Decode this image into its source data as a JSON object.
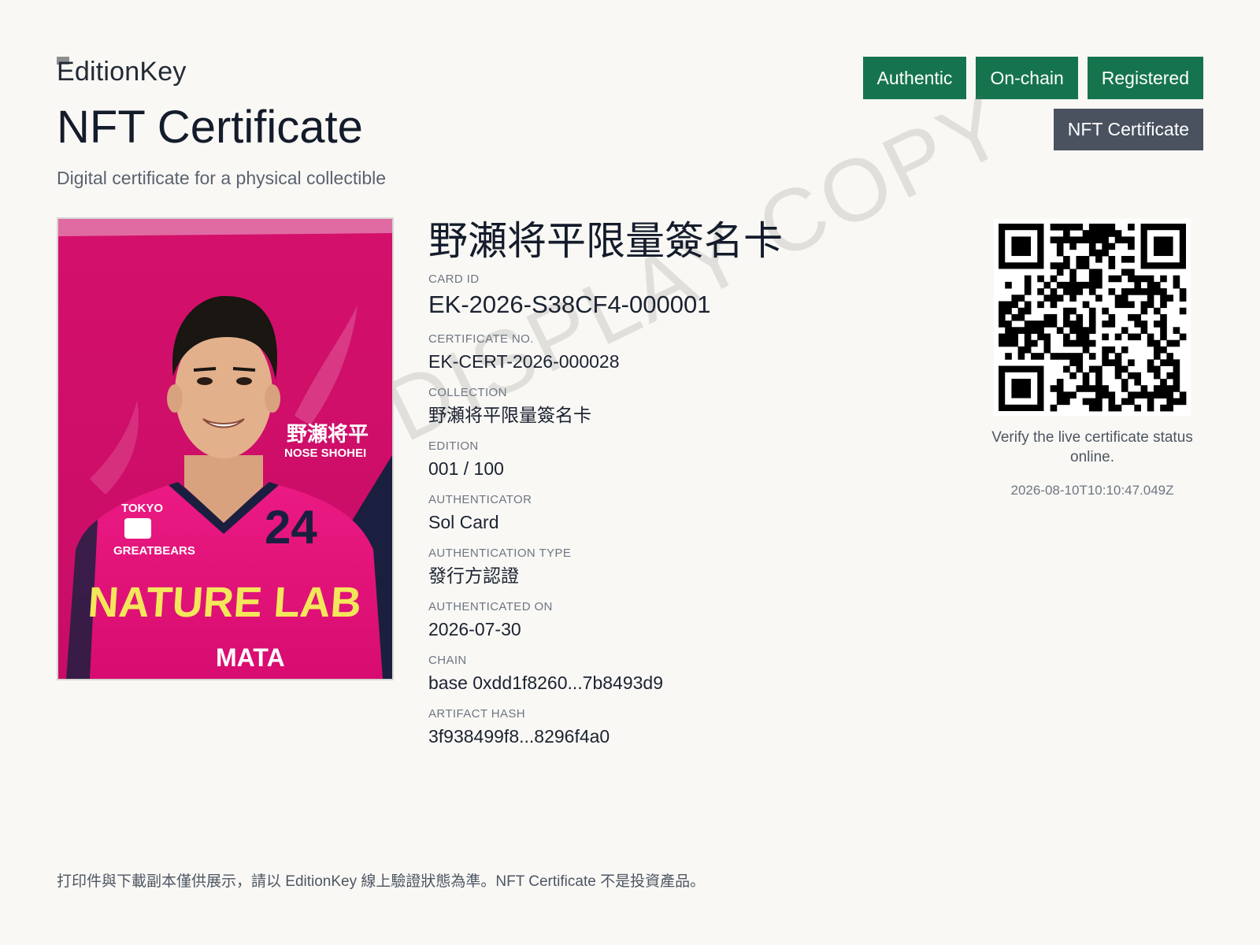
{
  "header": {
    "brand": "EditionKey",
    "title": "NFT Certificate",
    "subtitle": "Digital certificate  for a physical collectible"
  },
  "badges": [
    "Authentic",
    "On-chain",
    "Registered"
  ],
  "type_badge": "NFT Certificate",
  "watermark": "DISPLAY COPY",
  "card_image": {
    "overlay_name": "野瀬将平",
    "overlay_name_en": "NOSE SHOHEI",
    "jersey_number": "24",
    "team_text_1": "TOKYO",
    "team_text_2": "GREATBEARS",
    "sponsor": "NATURE LAB",
    "sponsor_2": "MATA",
    "colors": {
      "background": "#d8106e",
      "navy": "#1b1f3f",
      "yellow": "#f4e65a"
    }
  },
  "details": {
    "card_name": "野瀬将平限量簽名卡",
    "fields": [
      {
        "label": "CARD ID",
        "value": "EK-2026-S38CF4-000001"
      },
      {
        "label": "CERTIFICATE  NO.",
        "value": "EK-CERT-2026-000028"
      },
      {
        "label": "COLLECTION",
        "value": "野瀬将平限量簽名卡"
      },
      {
        "label": "EDITION",
        "value": "001 / 100"
      },
      {
        "label": "AUTHENTICATOR",
        "value": "Sol Card"
      },
      {
        "label": "AUTHENTICATION  TYPE",
        "value": "發行方認證"
      },
      {
        "label": "AUTHENTICATED  ON",
        "value": "2026-07-30"
      },
      {
        "label": "CHAIN",
        "value": "base 0xdd1f8260...7b8493d9"
      },
      {
        "label": "ARTIFACT  HASH",
        "value": "3f938499f8...8296f4a0"
      }
    ]
  },
  "qr": {
    "icon": "qr-code-icon",
    "verify_text": "Verify  the live certificate status online.",
    "timestamp": "2026-08-10T10:10:47.049Z"
  },
  "footer": {
    "disclaimer": "打印件與下載副本僅供展示，請以 EditionKey  線上驗證狀態為準。NFT Certificate  不是投資產品。"
  },
  "colors": {
    "accent_green": "#15744d",
    "badge_gray": "#4a5260",
    "page_bg": "#f9f8f5"
  }
}
